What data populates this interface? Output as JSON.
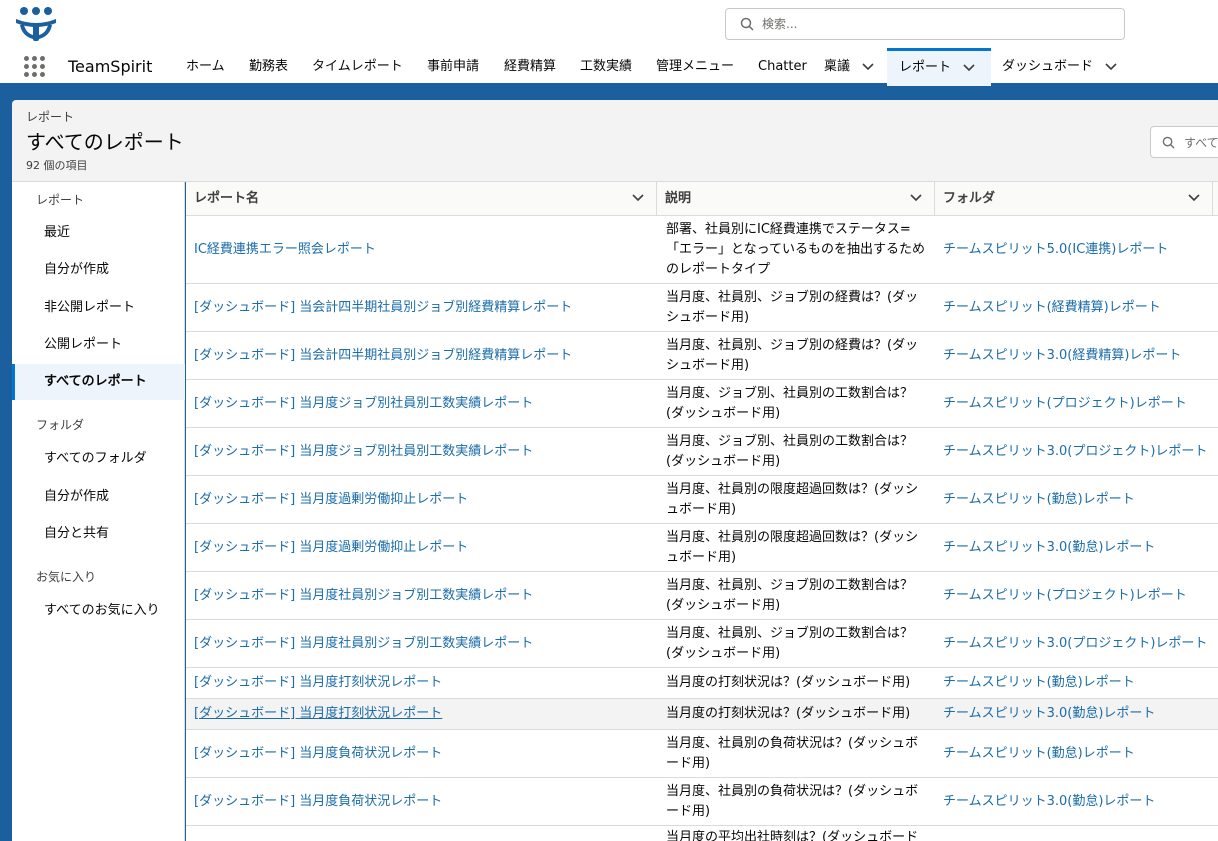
{
  "header": {
    "search_placeholder": "検索...",
    "app_name": "TeamSpirit"
  },
  "nav": {
    "items": [
      {
        "label": "ホーム"
      },
      {
        "label": "勤務表"
      },
      {
        "label": "タイムレポート"
      },
      {
        "label": "事前申請"
      },
      {
        "label": "経費精算"
      },
      {
        "label": "工数実績"
      },
      {
        "label": "管理メニュー"
      },
      {
        "label": "Chatter"
      },
      {
        "label": "稟議"
      },
      {
        "label": "レポート"
      },
      {
        "label": "ダッシュボード"
      }
    ]
  },
  "page": {
    "breadcrumb": "レポート",
    "title": "すべてのレポート",
    "count": "92 個の項目",
    "search_placeholder": "すべて"
  },
  "sidebar": {
    "section_reports": "レポート",
    "report_items": [
      "最近",
      "自分が作成",
      "非公開レポート",
      "公開レポート",
      "すべてのレポート"
    ],
    "section_folders": "フォルダ",
    "folder_items": [
      "すべてのフォルダ",
      "自分が作成",
      "自分と共有"
    ],
    "section_favorites": "お気に入り",
    "favorite_items": [
      "すべてのお気に入り"
    ]
  },
  "table": {
    "columns": [
      "レポート名",
      "説明",
      "フォルダ"
    ],
    "rows": [
      {
        "name": "IC経費連携エラー照会レポート",
        "desc": "部署、社員別にIC経費連携でステータス=「エラー」となっているものを抽出するためのレポートタイプ",
        "folder": "チームスピリット5.0(IC連携)レポート"
      },
      {
        "name": "[ダッシュボード] 当会計四半期社員別ジョブ別経費精算レポート",
        "desc": "当月度、社員別、ジョブ別の経費は？(ダッシュボード用)",
        "folder": "チームスピリット(経費精算)レポート"
      },
      {
        "name": "[ダッシュボード] 当会計四半期社員別ジョブ別経費精算レポート",
        "desc": "当月度、社員別、ジョブ別の経費は？(ダッシュボード用)",
        "folder": "チームスピリット3.0(経費精算)レポート"
      },
      {
        "name": "[ダッシュボード] 当月度ジョブ別社員別工数実績レポート",
        "desc": "当月度、ジョブ別、社員別の工数割合は？(ダッシュボード用)",
        "folder": "チームスピリット(プロジェクト)レポート"
      },
      {
        "name": "[ダッシュボード] 当月度ジョブ別社員別工数実績レポート",
        "desc": "当月度、ジョブ別、社員別の工数割合は？(ダッシュボード用)",
        "folder": "チームスピリット3.0(プロジェクト)レポート"
      },
      {
        "name": "[ダッシュボード] 当月度過剰労働抑止レポート",
        "desc": "当月度、社員別の限度超過回数は？(ダッシュボード用)",
        "folder": "チームスピリット(勤怠)レポート"
      },
      {
        "name": "[ダッシュボード] 当月度過剰労働抑止レポート",
        "desc": "当月度、社員別の限度超過回数は？(ダッシュボード用)",
        "folder": "チームスピリット3.0(勤怠)レポート"
      },
      {
        "name": "[ダッシュボード] 当月度社員別ジョブ別工数実績レポート",
        "desc": "当月度、社員別、ジョブ別の工数割合は？(ダッシュボード用)",
        "folder": "チームスピリット(プロジェクト)レポート"
      },
      {
        "name": "[ダッシュボード] 当月度社員別ジョブ別工数実績レポート",
        "desc": "当月度、社員別、ジョブ別の工数割合は？(ダッシュボード用)",
        "folder": "チームスピリット3.0(プロジェクト)レポート"
      },
      {
        "name": "[ダッシュボード] 当月度打刻状況レポート",
        "desc": "当月度の打刻状況は？(ダッシュボード用)",
        "folder": "チームスピリット(勤怠)レポート"
      },
      {
        "name": "[ダッシュボード] 当月度打刻状況レポート",
        "desc": "当月度の打刻状況は？(ダッシュボード用)",
        "folder": "チームスピリット3.0(勤怠)レポート"
      },
      {
        "name": "[ダッシュボード] 当月度負荷状況レポート",
        "desc": "当月度、社員別の負荷状況は？(ダッシュボード用)",
        "folder": "チームスピリット(勤怠)レポート"
      },
      {
        "name": "[ダッシュボード] 当月度負荷状況レポート",
        "desc": "当月度、社員別の負荷状況は？(ダッシュボード用)",
        "folder": "チームスピリット3.0(勤怠)レポート"
      },
      {
        "name": "",
        "desc": "当月度の平均出社時刻は？(ダッシュボード",
        "folder": ""
      }
    ]
  }
}
